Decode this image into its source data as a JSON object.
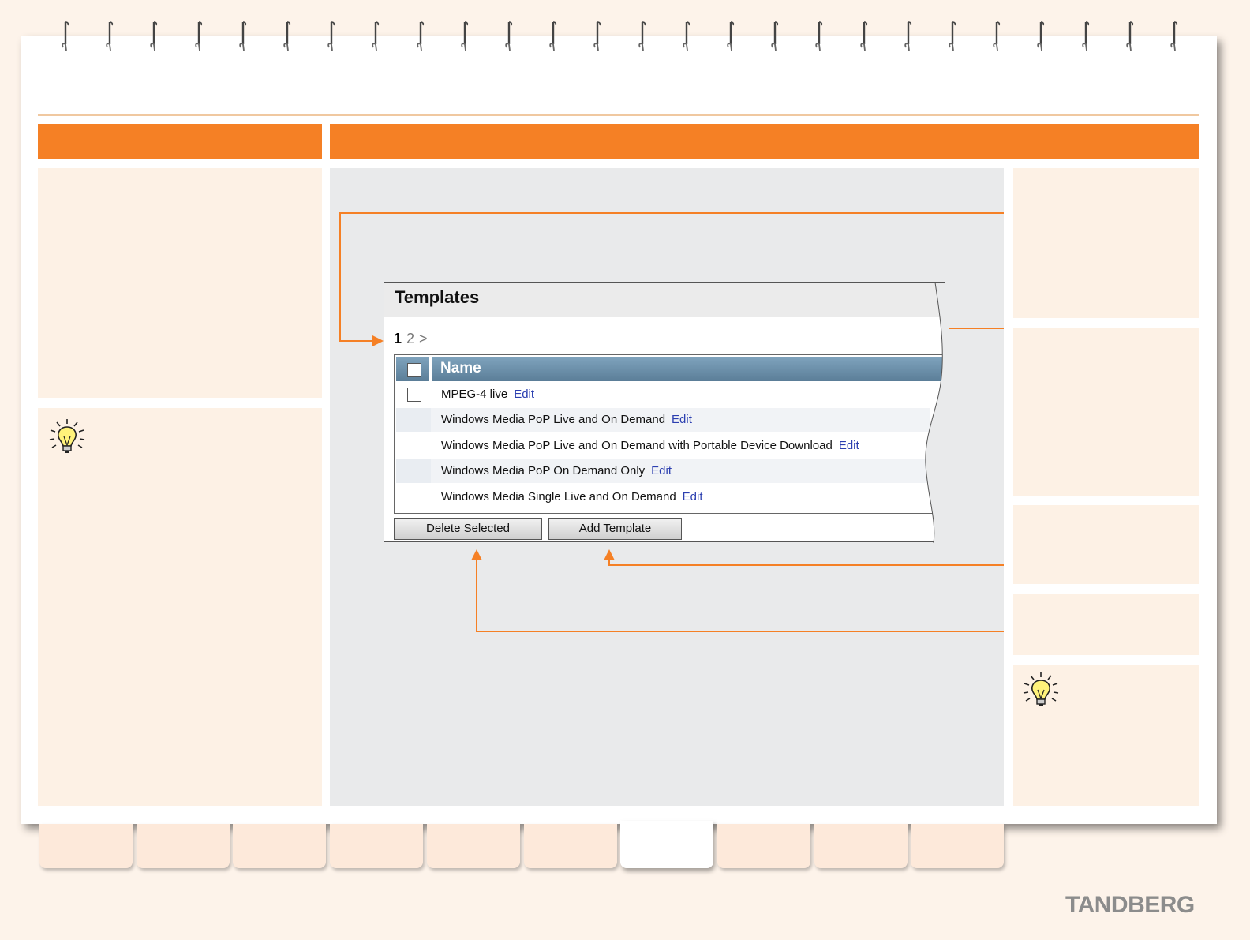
{
  "brand": {
    "logo": "TANDBERG"
  },
  "screenshot": {
    "title": "Templates",
    "pager": {
      "current": "1",
      "other": "2",
      "next": ">"
    },
    "table": {
      "column_header": "Name",
      "rows": [
        {
          "name": "MPEG-4 live",
          "edit": "Edit",
          "has_checkbox": true
        },
        {
          "name": "Windows Media PoP Live and On Demand",
          "edit": "Edit",
          "has_checkbox": false
        },
        {
          "name": "Windows Media PoP Live and On Demand with Portable Device Download",
          "edit": "Edit",
          "has_checkbox": false
        },
        {
          "name": "Windows Media PoP On Demand Only",
          "edit": "Edit",
          "has_checkbox": false
        },
        {
          "name": "Windows Media Single Live and On Demand",
          "edit": "Edit",
          "has_checkbox": false
        }
      ]
    },
    "buttons": {
      "delete": "Delete Selected",
      "add": "Add Template"
    }
  },
  "icons": {
    "tip_left": "lightbulb-icon",
    "tip_right": "lightbulb-icon"
  },
  "colors": {
    "accent": "#f58025",
    "panel": "#fdf1e5",
    "main_bg": "#e9eaeb",
    "link": "#2c3fb0"
  },
  "tabs": {
    "count": 10,
    "active_index": 6
  }
}
